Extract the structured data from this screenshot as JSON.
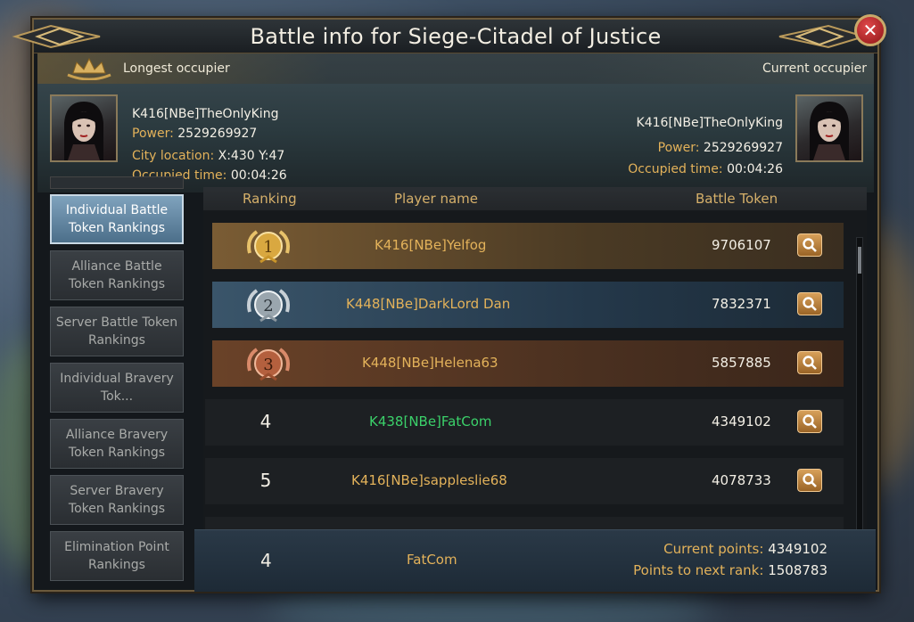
{
  "window": {
    "title": "Battle info for Siege-Citadel of Justice",
    "close_symbol": "✕"
  },
  "occupiers": {
    "longest": {
      "label": "Longest occupier",
      "name": "K416[NBe]TheOnlyKing",
      "power_label": "Power:",
      "power_value": "2529269927",
      "location_label": "City location:",
      "location_value": "X:430 Y:47",
      "time_label": "Occupied time:",
      "time_value": "00:04:26"
    },
    "current": {
      "label": "Current occupier",
      "name": "K416[NBe]TheOnlyKing",
      "power_label": "Power:",
      "power_value": "2529269927",
      "time_label": "Occupied time:",
      "time_value": "00:04:26"
    }
  },
  "sidebar": {
    "items": [
      {
        "label": "Individual Battle Token Rankings",
        "active": true
      },
      {
        "label": "Alliance Battle Token Rankings",
        "active": false
      },
      {
        "label": "Server Battle Token Rankings",
        "active": false
      },
      {
        "label": "Individual Bravery Tok...",
        "active": false
      },
      {
        "label": "Alliance Bravery Token Rankings",
        "active": false
      },
      {
        "label": "Server Bravery Token Rankings",
        "active": false
      },
      {
        "label": "Elimination Point Rankings",
        "active": false
      }
    ]
  },
  "table": {
    "headers": {
      "ranking": "Ranking",
      "player": "Player name",
      "token": "Battle Token"
    },
    "rows": [
      {
        "rank": "1",
        "player": "K416[NBe]Yelfog",
        "token": "9706107"
      },
      {
        "rank": "2",
        "player": "K448[NBe]DarkLord Dan",
        "token": "7832371"
      },
      {
        "rank": "3",
        "player": "K448[NBe]Helena63",
        "token": "5857885"
      },
      {
        "rank": "4",
        "player": "K438[NBe]FatCom",
        "token": "4349102"
      },
      {
        "rank": "5",
        "player": "K416[NBe]sappleslie68",
        "token": "4078733"
      }
    ]
  },
  "footer": {
    "rank": "4",
    "player": "FatCom",
    "current_points_label": "Current points:",
    "current_points_value": "4349102",
    "next_rank_label": "Points to next rank:",
    "next_rank_value": "1508783"
  },
  "colors": {
    "gold_text": "#e3b25a",
    "green_text": "#3bd16a",
    "row_gold": "#6a5030",
    "row_silver": "#2e4658",
    "row_bronze": "#5a3a24",
    "row_dark": "#1d2023",
    "active_tab": "#5b82a0"
  }
}
